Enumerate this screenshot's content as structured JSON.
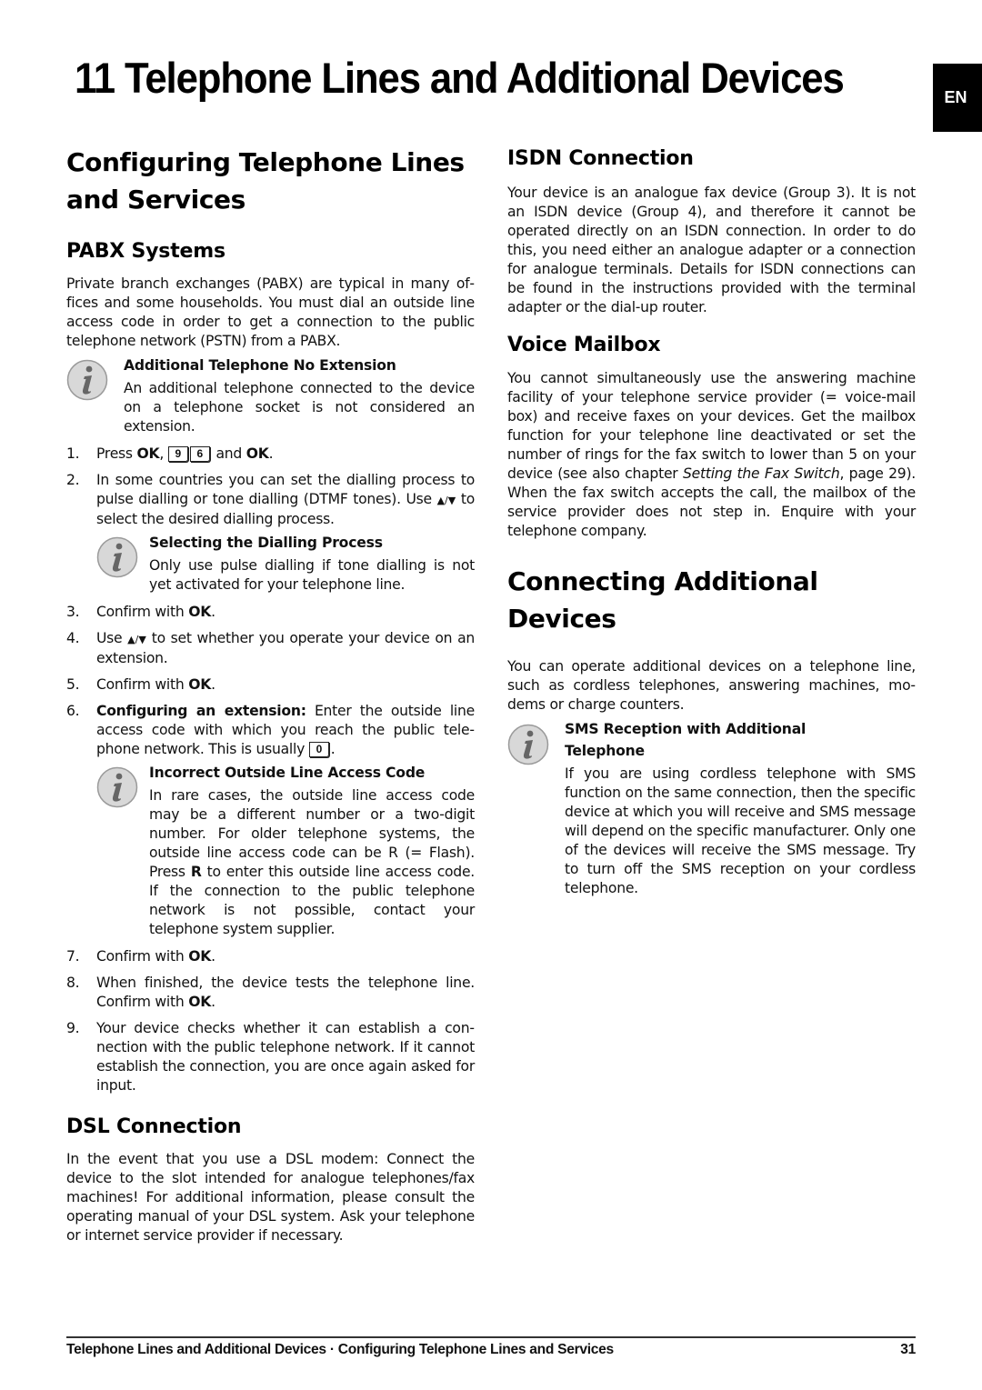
{
  "chapter": {
    "title": "11 Telephone Lines and Additional Devices",
    "language_tab": "EN"
  },
  "left_column": {
    "section_title": "Configuring Telephone Lines and Services",
    "pabx": {
      "title": "PABX Systems",
      "intro": "Private branch exchanges (PABX) are typical in many of­fices and some households. You must dial an outside line access code in order to get a connection to the public telephone network (PSTN) from a PABX.",
      "note_1": {
        "icon": "info-icon",
        "title": "Additional Telephone No Extension",
        "text": "An additional telephone connected to the de­vice on a telephone socket is not considered an extension."
      },
      "steps": [
        {
          "num": "1.",
          "pre": "Press ",
          "bold_1": "OK",
          "mid": ", ",
          "keys": [
            "9",
            "6"
          ],
          "post": " and ",
          "bold_2": "OK",
          "end": "."
        },
        {
          "num": "2.",
          "text_1": "In some countries you can set the dialling process to pulse dialling or tone dialling (DTMF tones). Use ",
          "arrows": "▲/▼",
          "text_2": " to select the desired dialling process."
        },
        {
          "num": "3.",
          "pre": "Confirm with ",
          "bold": "OK",
          "end": "."
        },
        {
          "num": "4.",
          "pre": "Use ",
          "arrows": "▲/▼",
          "post": " to set whether you operate your device on an extension."
        },
        {
          "num": "5.",
          "pre": "Confirm with ",
          "bold": "OK",
          "end": "."
        },
        {
          "num": "6.",
          "bold": "Configuring an extension:",
          "text": " Enter the outside line access code with which you reach the public tele­phone network. This is usually ",
          "key": "0",
          "end": "."
        },
        {
          "num": "7.",
          "pre": "Confirm with ",
          "bold": "OK",
          "end": "."
        },
        {
          "num": "8.",
          "pre": "When finished, the device tests the telephone line. Confirm with ",
          "bold": "OK",
          "end": "."
        },
        {
          "num": "9.",
          "text": "Your device checks whether it can establish a con­nection with the public telephone network. If it can­not establish the connection, you are once again asked for input."
        }
      ],
      "note_2": {
        "icon": "info-icon",
        "title": "Selecting the Dialling Process",
        "text": "Only use pulse dialling if tone dialling is not yet activated for your telephone line."
      },
      "note_3": {
        "icon": "info-icon",
        "title": "Incorrect Outside Line Access Code",
        "text_1": "In rare cases, the outside line access code may be a different number or a two-digit number. For older telephone systems, the outside line access code can be R (= Flash). Press ",
        "bold": "R",
        "text_2": " to enter this outside line access code. If the connection to the public tele­phone network is not possible, contact your telephone system supplier."
      }
    },
    "dsl": {
      "title": "DSL Connection",
      "text": "In the event that you use a DSL modem: Connect the device to the slot intended for analogue telephones/fax machines! For additional information, please consult the operating manual of your DSL system. Ask your tele­phone or internet service provider if necessary."
    }
  },
  "right_column": {
    "isdn": {
      "title": "ISDN Connection",
      "text": "Your device is an analogue fax device (Group 3). It is not an ISDN device (Group 4), and therefore it cannot be operated directly on an ISDN connection. In order to do this, you need either an analogue adapter or a con­nection for analogue terminals. Details for ISDN con­nections can be found in the instructions provided with the terminal adapter or the dial-up router."
    },
    "voice_mailbox": {
      "title": "Voice Mailbox",
      "text_1": "You cannot simultaneously use the answering machine facility of your telephone service provider (= voice-mail box) and receive faxes on your devices. Get the mail­box function for your telephone line deactivated or set the number of rings for the fax switch to lower than 5 on your device (see also chapter ",
      "italic": "Setting the Fax Switch",
      "text_2": ", page 29). When the fax switch accepts the call, the mail­box of the service provider does not step in. Enquire with your telephone company."
    },
    "additional_devices": {
      "title": "Connecting Additional Devices",
      "text": "You can operate additional devices on a telephone line, such as cordless telephones, answering machines, mo­dems or charge counters.",
      "note": {
        "icon": "info-icon",
        "title": "SMS Reception with Additional Telephone",
        "text": "If you are using cordless telephone with SMS function on the same connection, then the spe­cific device at which you will receive and SMS message will depend on the specific manufactur­er. Only one of the devices will receive the SMS message. Try to turn off the SMS reception on your cordless telephone."
      }
    }
  },
  "footer": {
    "breadcrumb": "Telephone Lines and Additional Devices · Configuring Telephone Lines and Services",
    "page_number": "31"
  }
}
